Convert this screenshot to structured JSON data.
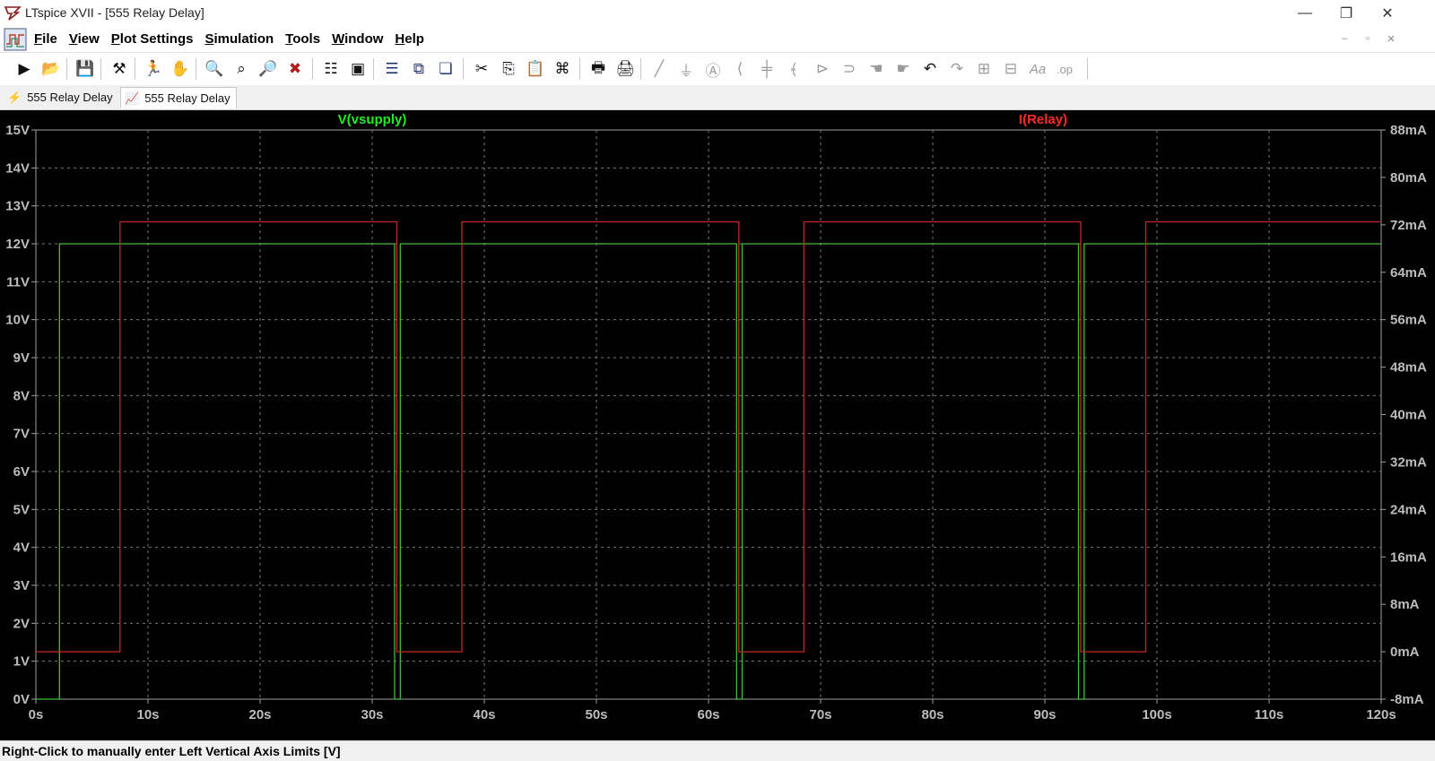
{
  "window": {
    "title": "LTspice XVII - [555 Relay Delay]",
    "minimize_glyph": "—",
    "restore_glyph": "❐",
    "close_glyph": "✕"
  },
  "menu": [
    {
      "underline": "F",
      "rest": "ile"
    },
    {
      "underline": "V",
      "rest": "iew"
    },
    {
      "underline": "P",
      "rest": "lot Settings"
    },
    {
      "underline": "S",
      "rest": "imulation"
    },
    {
      "underline": "T",
      "rest": "ools"
    },
    {
      "underline": "W",
      "rest": "indow"
    },
    {
      "underline": "H",
      "rest": "elp"
    }
  ],
  "mdi": {
    "minimize": "–",
    "restore": "▫",
    "close": "✕"
  },
  "toolbar": {
    "run": "▶",
    "open": "📂",
    "save": "💾",
    "control_panel": "⚒",
    "halt": "🏃",
    "pan": "✋",
    "zoom_in": "🔍",
    "zoom_full": "⌕",
    "zoom_out": "🔎",
    "zoom_cancel": "✖",
    "autorange": "☷",
    "plot_settings": "▣",
    "tile_h": "☰",
    "tile_v": "⧉",
    "cascade": "❏",
    "cut": "✂",
    "copy": "⎘",
    "paste": "📋",
    "find": "⌘",
    "print": "🖶",
    "print_setup": "🖨",
    "wire": "╱",
    "ground": "⏚",
    "label": "Ⓐ",
    "resistor": "⟨",
    "capacitor": "╪",
    "inductor": "﴾",
    "diode": "⊳",
    "component": "⊃",
    "move": "☚",
    "drag": "☛",
    "undo": "↶",
    "redo": "↷",
    "rotate": "⊞",
    "mirror": "⊟",
    "text": "Aa",
    "spice": ".op"
  },
  "tabs": [
    {
      "icon": "⚡",
      "label": "555 Relay Delay"
    },
    {
      "icon": "📈",
      "label": "555 Relay Delay"
    }
  ],
  "chart_data": {
    "type": "line",
    "title": "",
    "xlabel": "",
    "ylabel_left": "",
    "ylabel_right": "",
    "xlim": [
      0,
      120
    ],
    "ylim_left": [
      0,
      15
    ],
    "ylim_right": [
      -8,
      88
    ],
    "grid": true,
    "x_ticks": [
      "0s",
      "10s",
      "20s",
      "30s",
      "40s",
      "50s",
      "60s",
      "70s",
      "80s",
      "90s",
      "100s",
      "110s",
      "120s"
    ],
    "y_left_ticks": [
      "0V",
      "1V",
      "2V",
      "3V",
      "4V",
      "5V",
      "6V",
      "7V",
      "8V",
      "9V",
      "10V",
      "11V",
      "12V",
      "13V",
      "14V",
      "15V"
    ],
    "y_right_ticks": [
      "-8mA",
      "0mA",
      "8mA",
      "16mA",
      "24mA",
      "32mA",
      "40mA",
      "48mA",
      "56mA",
      "64mA",
      "72mA",
      "80mA",
      "88mA"
    ],
    "series": [
      {
        "name": "V(vsupply)",
        "axis": "left",
        "color": "#3fbf3f",
        "label_color": "#22ee22",
        "x": [
          0,
          2.1,
          2.1,
          32.0,
          32.0,
          32.5,
          32.5,
          62.5,
          62.5,
          63.0,
          63.0,
          93.0,
          93.0,
          93.5,
          93.5,
          120
        ],
        "y": [
          0,
          0,
          12,
          12,
          0,
          0,
          12,
          12,
          0,
          0,
          12,
          12,
          0,
          0,
          12,
          12
        ]
      },
      {
        "name": "I(Relay)",
        "axis": "right",
        "color": "#c62828",
        "label_color": "#ff2a2a",
        "x": [
          0,
          7.5,
          7.5,
          32.2,
          32.2,
          38.0,
          38.0,
          62.7,
          62.7,
          68.5,
          68.5,
          93.2,
          93.2,
          99.0,
          99.0,
          120
        ],
        "y": [
          0,
          0,
          72.5,
          72.5,
          0,
          0,
          72.5,
          72.5,
          0,
          0,
          72.5,
          72.5,
          0,
          0,
          72.5,
          72.5
        ]
      }
    ]
  },
  "status": {
    "text": "Right-Click to manually enter Left Vertical Axis Limits [V]"
  }
}
